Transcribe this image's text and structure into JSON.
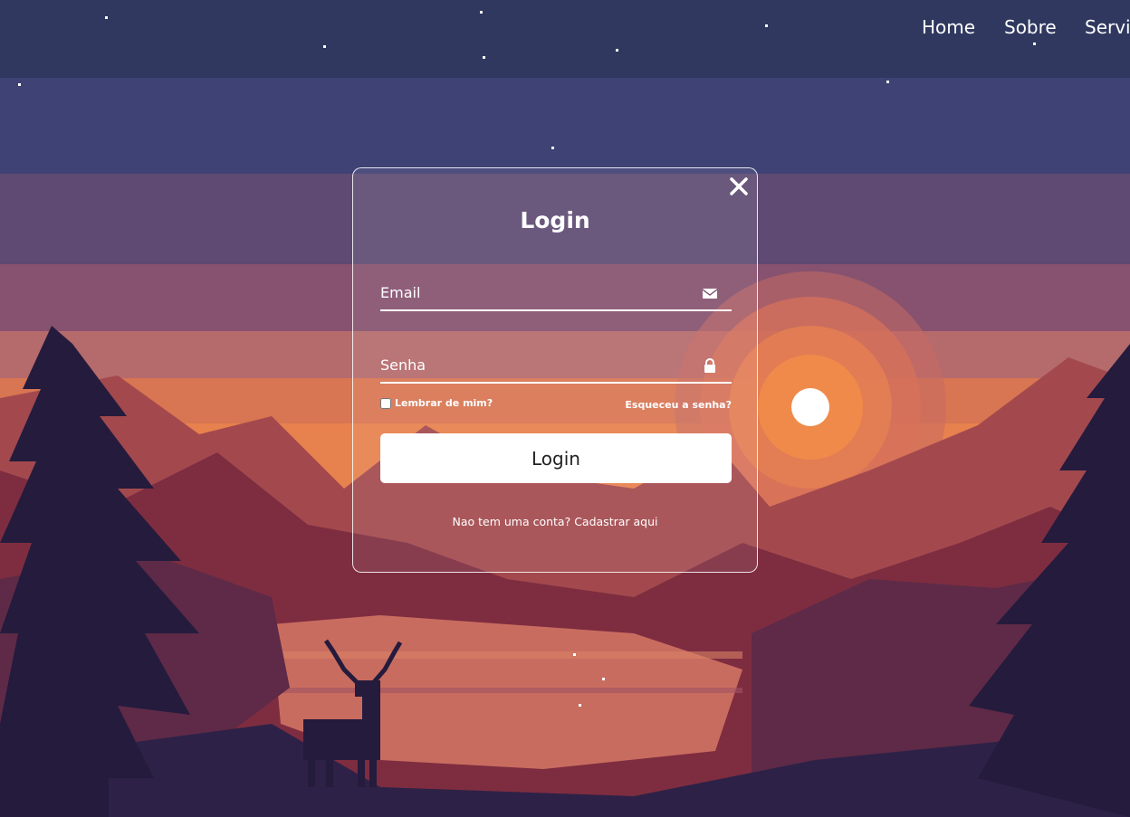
{
  "nav": {
    "items": [
      "Home",
      "Sobre",
      "Servi"
    ]
  },
  "modal": {
    "title": "Login",
    "email_placeholder": "Email",
    "password_placeholder": "Senha",
    "remember_label": "Lembrar de mim?",
    "forgot_label": "Esqueceu a senha?",
    "submit_label": "Login",
    "register_prefix": "Nao tem uma conta?",
    "register_link": "Cadastrar aqui"
  },
  "colors": {
    "sky_top": "#30385f",
    "sun": "#ffffff",
    "sun_glow": "#ee8a4c",
    "silhouette": "#241b3d"
  },
  "icons": [
    "close-icon",
    "envelope-icon",
    "lock-icon"
  ]
}
